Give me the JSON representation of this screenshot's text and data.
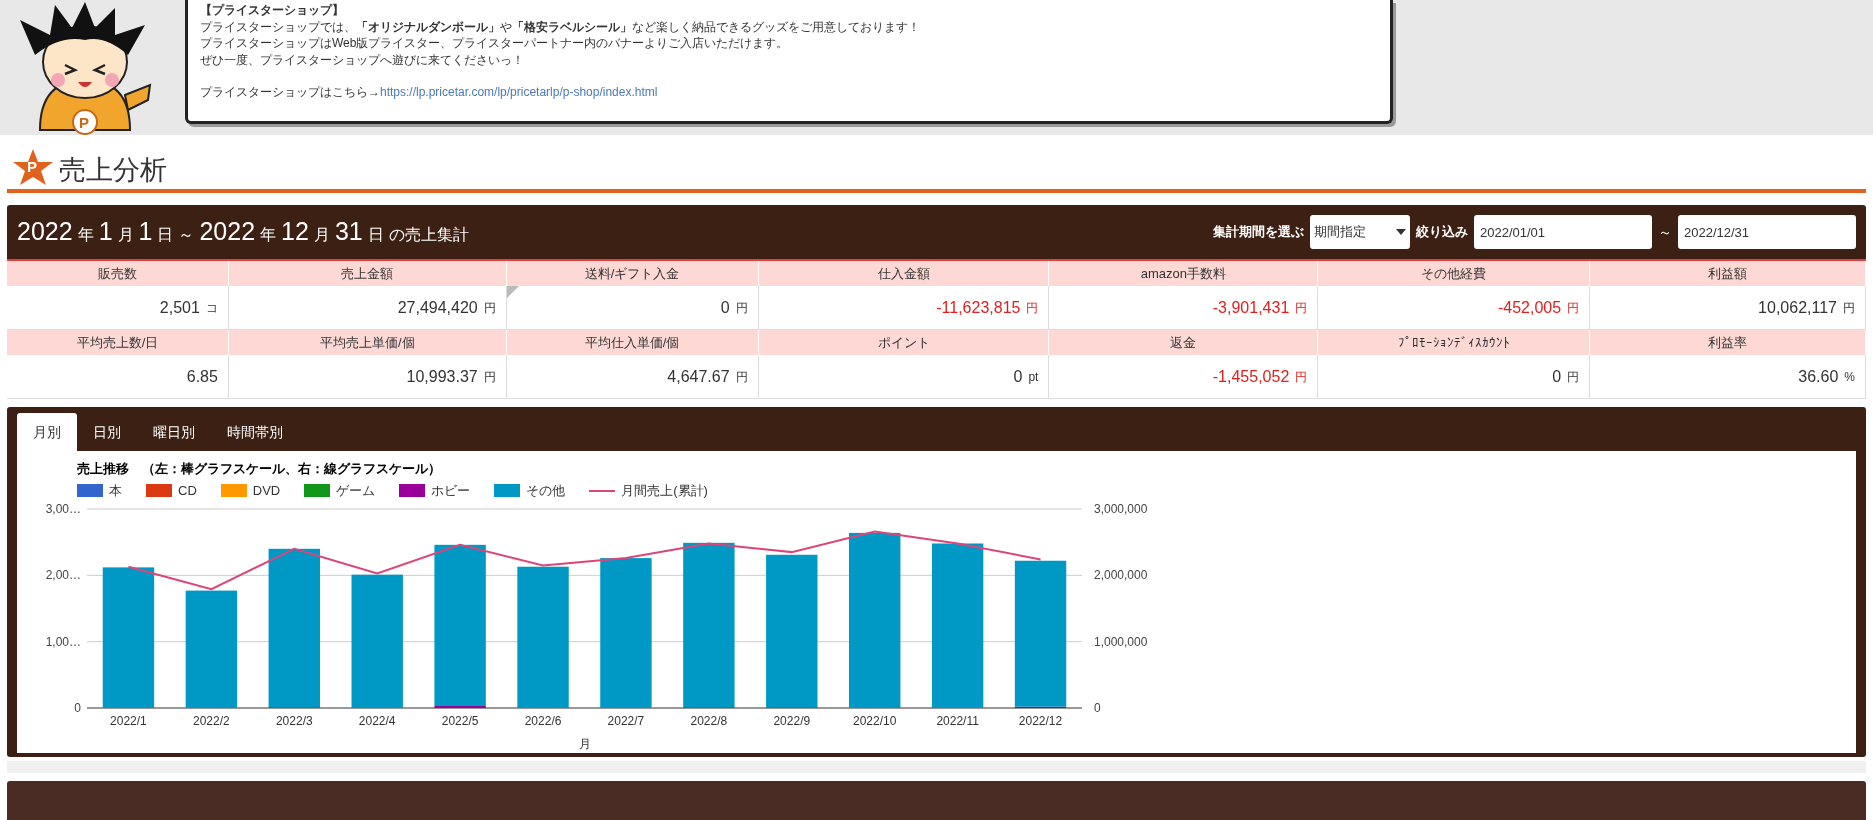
{
  "banner": {
    "mascot_letter": "P",
    "heading": "【プライスターショップ】",
    "lines": [
      "プライスターショップでは、**「オリジナルダンボール」**や**「格安ラベルシール」**など楽しく納品できるグッズをご用意しております！",
      "プライスターショップはWeb版プライスター、プライスターパートナー内のバナーよりご入店いただけます。",
      "ぜひ一度、プライスターショップへ遊びに来てくださいっ！"
    ],
    "link_prefix": "プライスターショップはこちら→",
    "link": "https://lp.pricetar.com/lp/pricetarlp/p-shop/index.html"
  },
  "page_title": {
    "logo_letter": "P",
    "text": "売上分析"
  },
  "period": {
    "segments": [
      {
        "text": "2022",
        "kind": "big"
      },
      {
        "text": "年",
        "kind": "small"
      },
      {
        "text": "1",
        "kind": "big"
      },
      {
        "text": "月",
        "kind": "small"
      },
      {
        "text": "1",
        "kind": "big"
      },
      {
        "text": "日",
        "kind": "small"
      },
      {
        "text": "～",
        "kind": "small"
      },
      {
        "text": "2022",
        "kind": "big"
      },
      {
        "text": "年",
        "kind": "small"
      },
      {
        "text": "12",
        "kind": "big"
      },
      {
        "text": "月",
        "kind": "small"
      },
      {
        "text": "31",
        "kind": "big"
      },
      {
        "text": "日",
        "kind": "small"
      },
      {
        "text": "の売上集計",
        "kind": "small"
      }
    ],
    "select_label": "集計期間を選ぶ",
    "select_value": "期間指定",
    "filter_label": "絞り込み",
    "from": "2022/01/01",
    "separator": "～",
    "to": "2022/12/31"
  },
  "stats": [
    [
      {
        "label": "販売数",
        "value": "2,501",
        "unit": "コ",
        "negative": false
      },
      {
        "label": "売上金額",
        "value": "27,494,420",
        "unit": "円",
        "negative": false
      },
      {
        "label": "送料/ギフト入金",
        "value": "0",
        "unit": "円",
        "negative": false
      },
      {
        "label": "仕入金額",
        "value": "-11,623,815",
        "unit": "円",
        "negative": true
      },
      {
        "label": "amazon手数料",
        "value": "-3,901,431",
        "unit": "円",
        "negative": true
      },
      {
        "label": "その他経費",
        "value": "-452,005",
        "unit": "円",
        "negative": true
      },
      {
        "label": "利益額",
        "value": "10,062,117",
        "unit": "円",
        "negative": false
      }
    ],
    [
      {
        "label": "平均売上数/日",
        "value": "6.85",
        "negative": false
      },
      {
        "label": "平均売上単価/個",
        "value": "10,993.37",
        "unit": "円",
        "negative": false
      },
      {
        "label": "平均仕入単価/個",
        "value": "4,647.67",
        "unit": "円",
        "negative": false
      },
      {
        "label": "ポイント",
        "value": "0",
        "unit": "pt",
        "negative": false
      },
      {
        "label": "返金",
        "value": "-1,455,052",
        "unit": "円",
        "negative": true
      },
      {
        "label": "ﾌﾟﾛﾓｰｼｮﾝﾃﾞｨｽｶｳﾝﾄ",
        "value": "0",
        "unit": "円",
        "negative": false
      },
      {
        "label": "利益率",
        "value": "36.60",
        "unit": "%",
        "negative": false
      }
    ]
  ],
  "tabs": [
    {
      "label": "月別",
      "selected": true
    },
    {
      "label": "日別",
      "selected": false
    },
    {
      "label": "曜日別",
      "selected": false
    },
    {
      "label": "時間帯別",
      "selected": false
    }
  ],
  "chart": {
    "left_axis_labels": [
      "3,00…",
      "2,00…",
      "1,00…",
      "0"
    ],
    "chart_data": {
      "type": "bar",
      "stacked": true,
      "title": "売上推移　（左：棒グラフスケール、右：線グラフスケール）",
      "xlabel": "月",
      "categories": [
        "2022/1",
        "2022/2",
        "2022/3",
        "2022/4",
        "2022/5",
        "2022/6",
        "2022/7",
        "2022/8",
        "2022/9",
        "2022/10",
        "2022/11",
        "2022/12"
      ],
      "ylim": [
        0,
        3000000
      ],
      "yticks": [
        0,
        {
          "value": 1000000,
          "label": "1,000,000"
        },
        {
          "value": 2000000,
          "label": "2,000,000"
        },
        {
          "value": 3000000,
          "label": "3,000,000"
        }
      ],
      "series": [
        {
          "name": "本",
          "color": "#3366cc",
          "values": [
            0,
            0,
            0,
            0,
            0,
            0,
            0,
            0,
            0,
            0,
            0,
            0
          ]
        },
        {
          "name": "CD",
          "color": "#dc3912",
          "values": [
            0,
            0,
            0,
            0,
            0,
            0,
            0,
            0,
            0,
            0,
            0,
            0
          ]
        },
        {
          "name": "DVD",
          "color": "#ff9900",
          "values": [
            0,
            0,
            0,
            0,
            0,
            0,
            0,
            0,
            0,
            0,
            0,
            0
          ]
        },
        {
          "name": "ゲーム",
          "color": "#109618",
          "values": [
            0,
            0,
            0,
            0,
            0,
            0,
            0,
            0,
            0,
            0,
            0,
            0
          ]
        },
        {
          "name": "ホビー",
          "color": "#990099",
          "values": [
            0,
            0,
            10000,
            0,
            30000,
            0,
            0,
            10000,
            10000,
            0,
            0,
            20000
          ]
        },
        {
          "name": "その他",
          "color": "#0099c6",
          "values": [
            2120000,
            1770000,
            2390000,
            2010000,
            2430000,
            2130000,
            2260000,
            2480000,
            2300000,
            2640000,
            2480000,
            2200000
          ]
        },
        {
          "name": "月間売上(累計)",
          "color": "#dd4477",
          "type": "line",
          "values": [
            2130000,
            1790000,
            2400000,
            2030000,
            2460000,
            2150000,
            2260000,
            2480000,
            2350000,
            2660000,
            2480000,
            2240000
          ]
        }
      ]
    }
  }
}
